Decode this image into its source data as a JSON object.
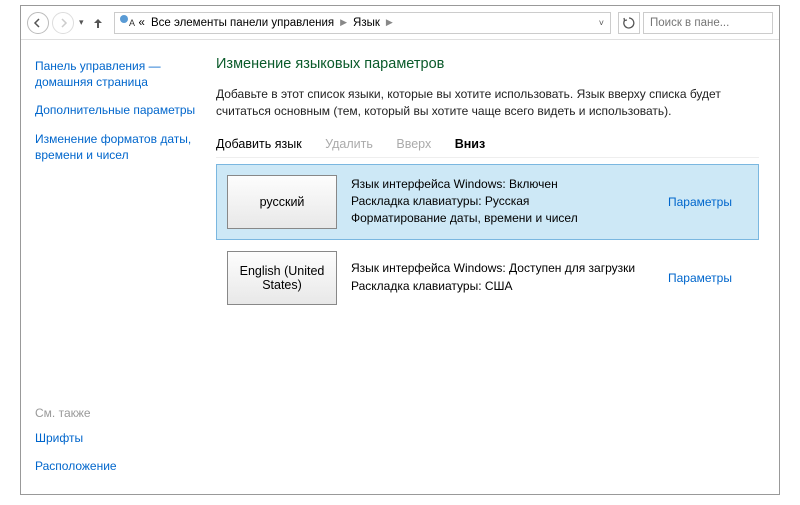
{
  "toolbar": {
    "breadcrumb_prefix": "«",
    "crumb1": "Все элементы панели управления",
    "crumb2": "Язык",
    "search_placeholder": "Поиск в пане..."
  },
  "sidebar": {
    "home": "Панель управления — домашняя страница",
    "advanced": "Дополнительные параметры",
    "formats": "Изменение форматов даты, времени и чисел",
    "see_also_label": "См. также",
    "fonts": "Шрифты",
    "location": "Расположение"
  },
  "content": {
    "title": "Изменение языковых параметров",
    "description": "Добавьте в этот список языки, которые вы хотите использовать. Язык вверху списка будет считаться основным (тем, который вы хотите чаще всего видеть и использовать).",
    "cmd_add": "Добавить язык",
    "cmd_remove": "Удалить",
    "cmd_up": "Вверх",
    "cmd_down": "Вниз",
    "languages": [
      {
        "name": "русский",
        "line1": "Язык интерфейса Windows: Включен",
        "line2": "Раскладка клавиатуры: Русская",
        "line3": "Форматирование даты, времени и чисел",
        "options": "Параметры"
      },
      {
        "name": "English (United States)",
        "line1": "Язык интерфейса Windows: Доступен для загрузки",
        "line2": "Раскладка клавиатуры: США",
        "line3": "",
        "options": "Параметры"
      }
    ]
  }
}
